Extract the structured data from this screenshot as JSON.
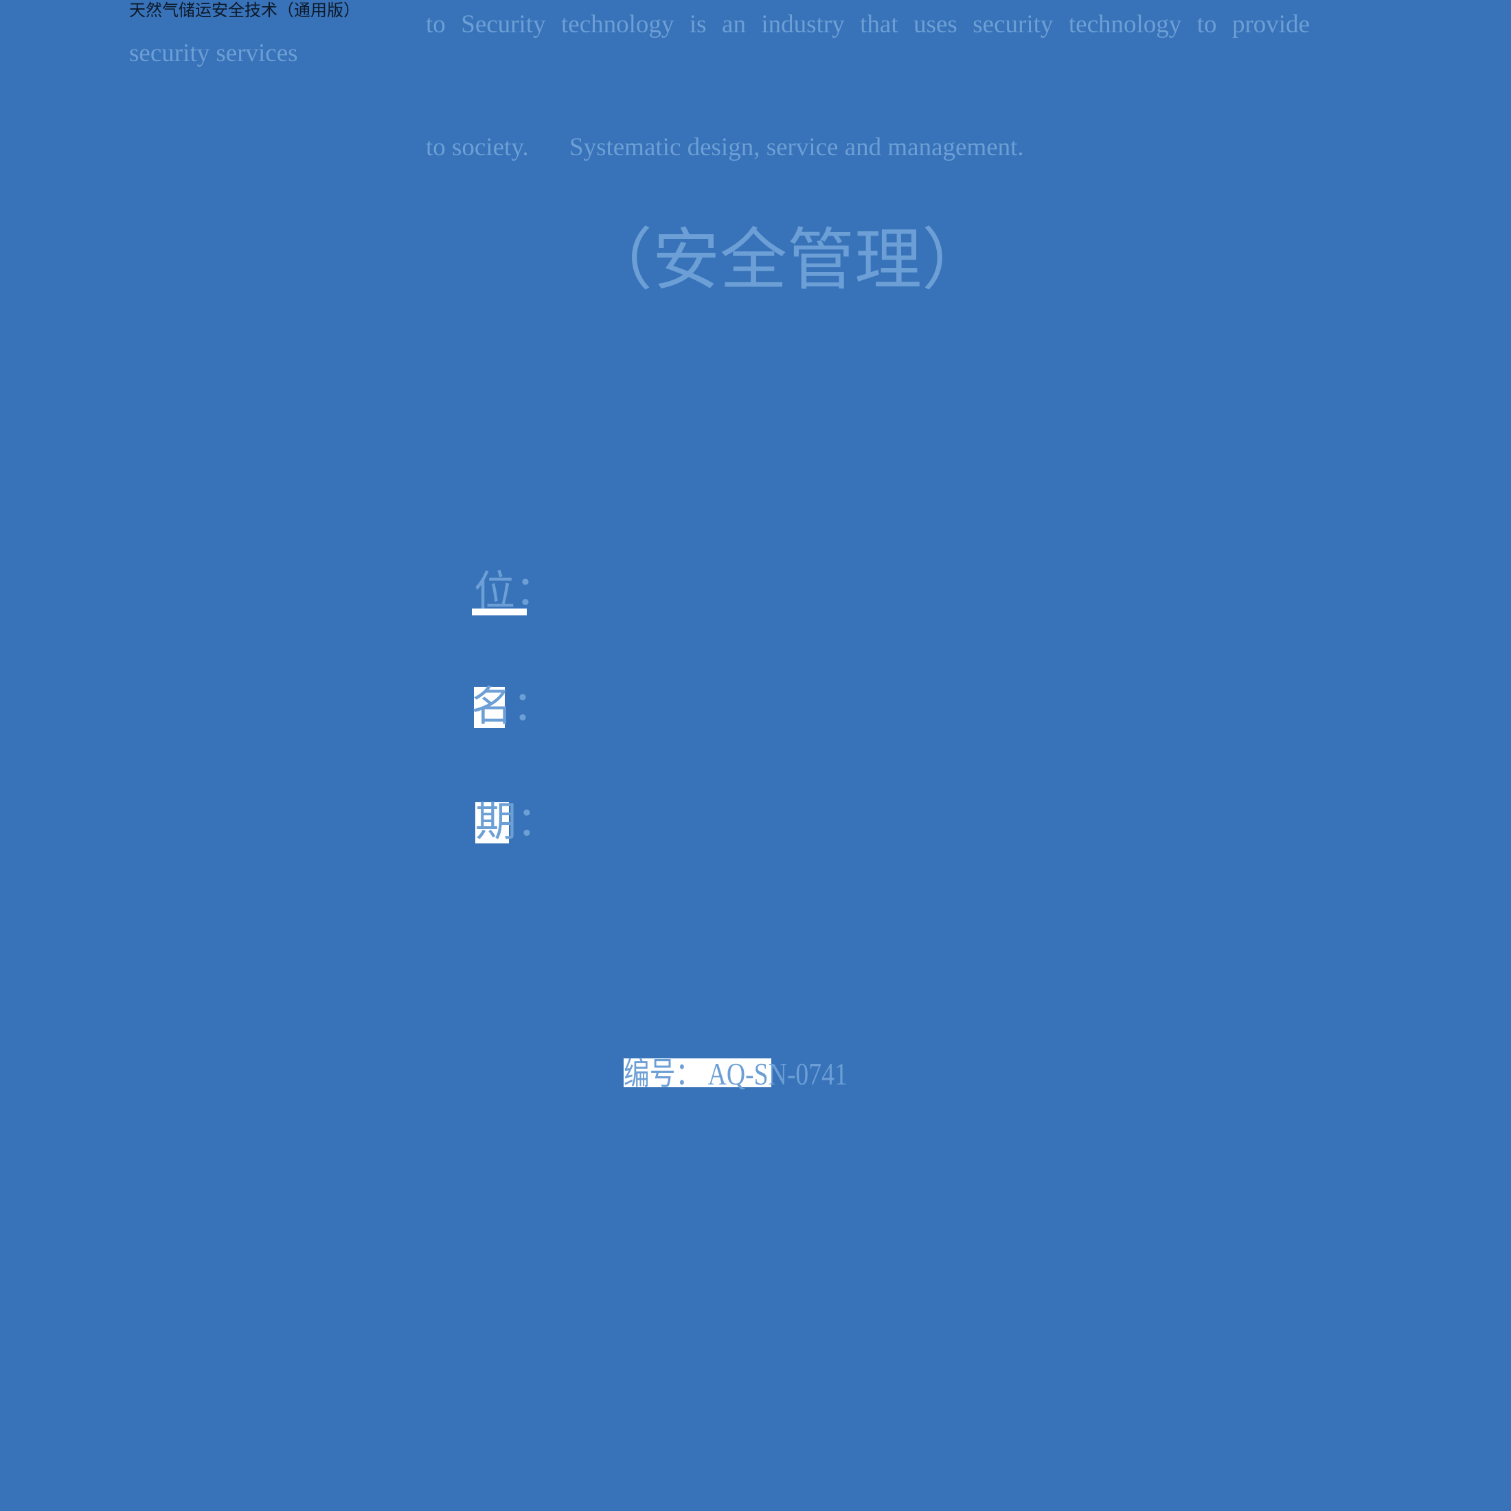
{
  "page": {
    "background_color": "#3872b8",
    "faint_text_color": "#6c9fd5",
    "header_text_color": "#0d1a2a"
  },
  "header": {
    "doc_title": "天然气储运安全技术（通用版）"
  },
  "intro": {
    "left_fragment": "security services",
    "line_1": "to Security technology is an industry that uses security technology to provide",
    "line_2a": "to society.",
    "line_2b": "Systematic design, service and management."
  },
  "main_title": "（安全管理）",
  "fields": [
    {
      "label": "位："
    },
    {
      "label": "名："
    },
    {
      "label": "期："
    }
  ],
  "doc_number": {
    "label": "编号：",
    "value": "AQ-SN-0741",
    "full": "编号：  AQ-SN-0741"
  }
}
